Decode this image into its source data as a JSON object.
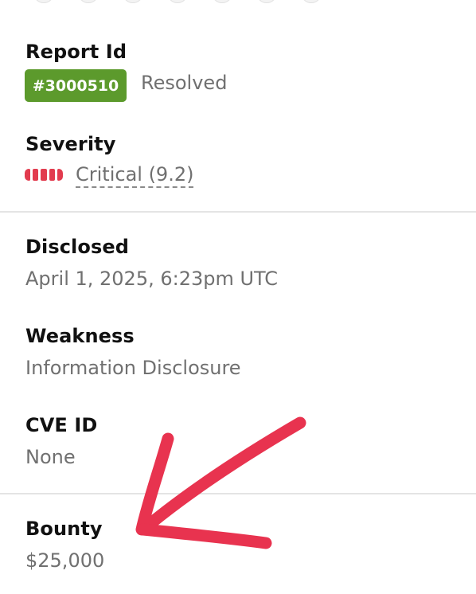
{
  "report": {
    "label": "Report Id",
    "id": "#3000510",
    "status": "Resolved"
  },
  "severity": {
    "label": "Severity",
    "text": "Critical (9.2)",
    "bars_filled": 5,
    "bars_total": 5,
    "color": "#e23b4e"
  },
  "disclosed": {
    "label": "Disclosed",
    "value": "April 1, 2025, 6:23pm UTC"
  },
  "weakness": {
    "label": "Weakness",
    "value": "Information Disclosure"
  },
  "cve": {
    "label": "CVE ID",
    "value": "None"
  },
  "bounty": {
    "label": "Bounty",
    "value": "$25,000"
  },
  "colors": {
    "badge": "#5c9a2c",
    "annotation_arrow": "#e8334f",
    "label_text": "#111111",
    "value_text": "#707070"
  },
  "annotation": {
    "icon": "hand-drawn-arrow-icon"
  }
}
